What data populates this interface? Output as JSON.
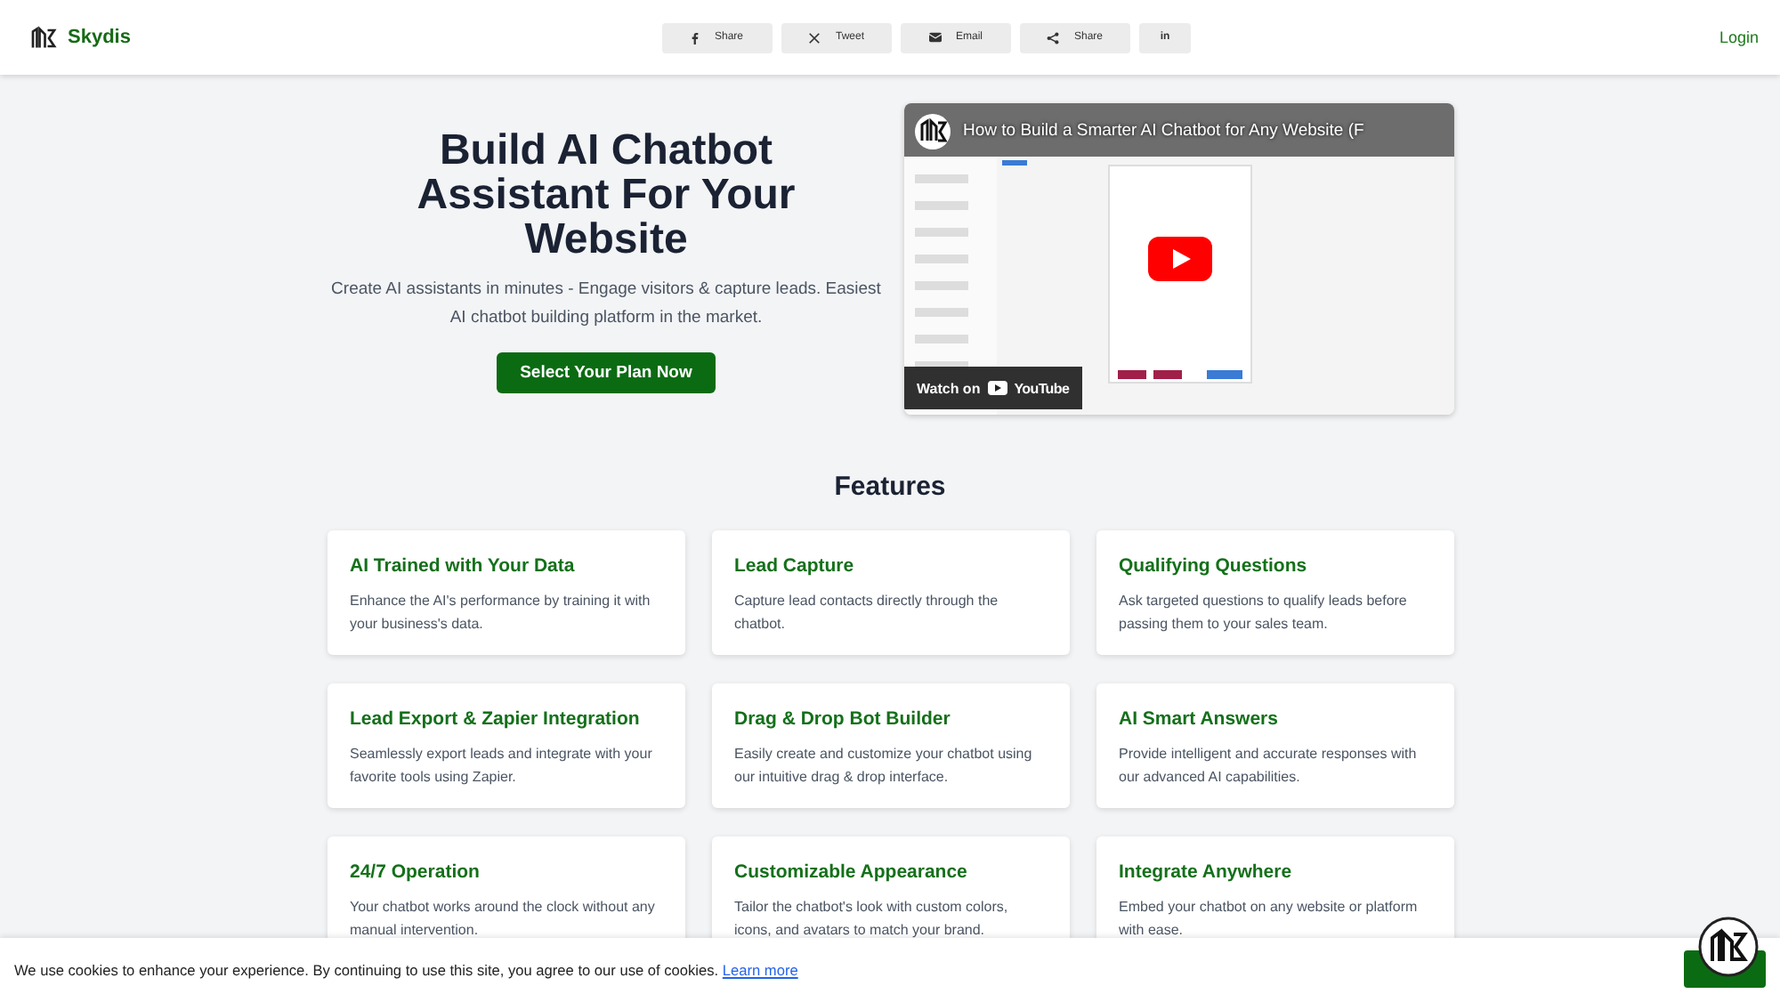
{
  "header": {
    "brand": "Skydis",
    "share_buttons": [
      {
        "kind": "facebook",
        "label": "Share"
      },
      {
        "kind": "x",
        "label": "Tweet"
      },
      {
        "kind": "email",
        "label": "Email"
      },
      {
        "kind": "share",
        "label": "Share"
      },
      {
        "kind": "linkedin",
        "label": "in"
      }
    ],
    "login": "Login"
  },
  "hero": {
    "title": "Build AI Chatbot Assistant For Your Website",
    "subtitle": "Create AI assistants in minutes - Engage visitors & capture leads. Easiest AI chatbot building platform in the market.",
    "cta": "Select Your Plan Now",
    "video": {
      "title": "How to Build a Smarter AI Chatbot for Any Website (F",
      "watch_on": "Watch on",
      "platform": "YouTube"
    }
  },
  "features": {
    "heading": "Features",
    "items": [
      {
        "title": "AI Trained with Your Data",
        "text": "Enhance the AI's performance by training it with your business's data."
      },
      {
        "title": "Lead Capture",
        "text": "Capture lead contacts directly through the chatbot."
      },
      {
        "title": "Qualifying Questions",
        "text": "Ask targeted questions to qualify leads before passing them to your sales team."
      },
      {
        "title": "Lead Export & Zapier Integration",
        "text": "Seamlessly export leads and integrate with your favorite tools using Zapier."
      },
      {
        "title": "Drag & Drop Bot Builder",
        "text": "Easily create and customize your chatbot using our intuitive drag & drop interface."
      },
      {
        "title": "AI Smart Answers",
        "text": "Provide intelligent and accurate responses with our advanced AI capabilities."
      },
      {
        "title": "24/7 Operation",
        "text": "Your chatbot works around the clock without any manual intervention."
      },
      {
        "title": "Customizable Appearance",
        "text": "Tailor the chatbot's look with custom colors, icons, and avatars to match your brand."
      },
      {
        "title": "Integrate Anywhere",
        "text": "Embed your chatbot on any website or platform with ease."
      }
    ]
  },
  "cookie_bar": {
    "text": "We use cookies to enhance your experience. By continuing to use this site, you agree to our use of cookies.",
    "link": "Learn more"
  }
}
